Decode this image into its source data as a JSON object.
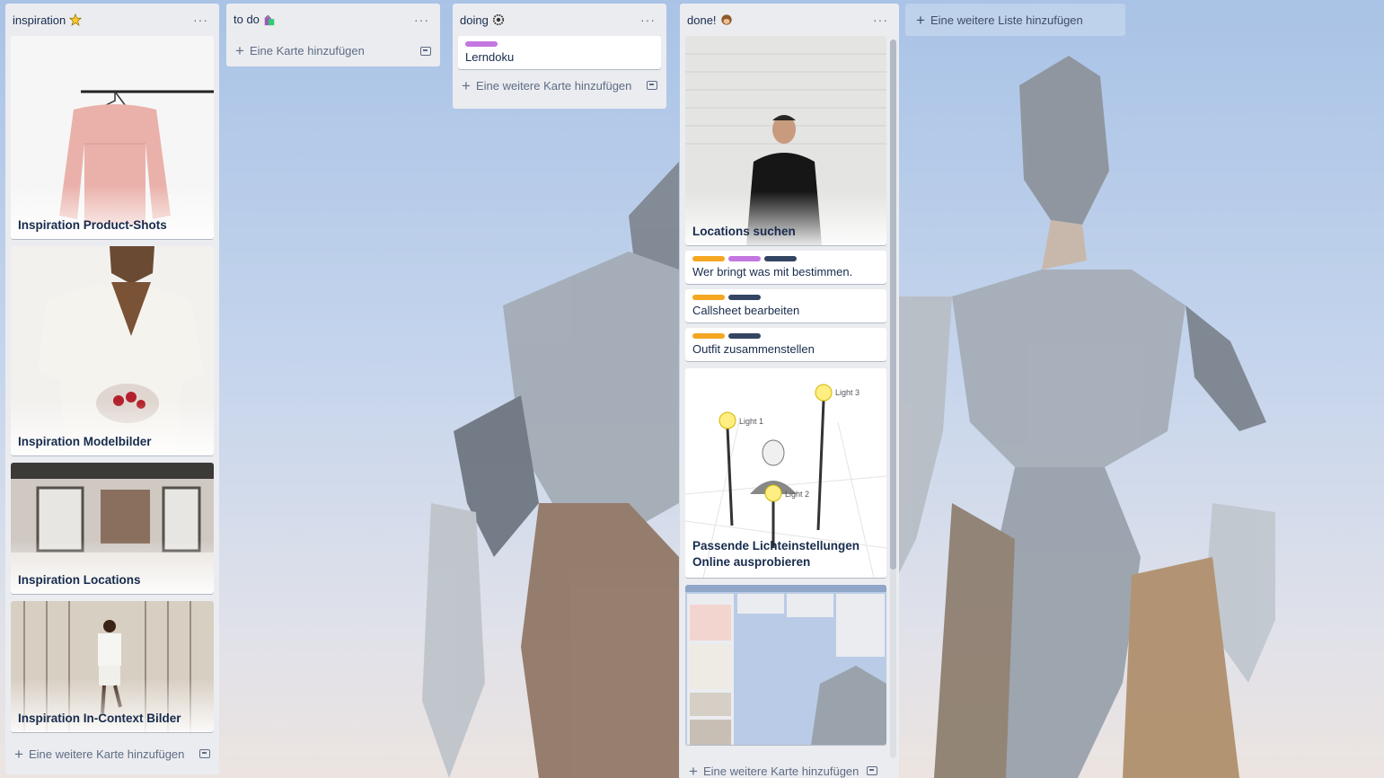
{
  "colors": {
    "label_orange": "#f5a623",
    "label_purple": "#c377e0",
    "label_navy": "#344563",
    "list_bg": "#ebecf0"
  },
  "lists": [
    {
      "title": "inspiration",
      "emoji": "star",
      "add_card": "Eine weitere Karte hinzufügen",
      "cards": [
        {
          "title": "Inspiration Product-Shots"
        },
        {
          "title": "Inspiration Modelbilder"
        },
        {
          "title": "Inspiration Locations"
        },
        {
          "title": "Inspiration In-Context Bilder"
        }
      ]
    },
    {
      "title": "to do",
      "emoji": "shopping-bags",
      "add_card": "Eine Karte hinzufügen"
    },
    {
      "title": "doing",
      "emoji": "gear",
      "add_card": "Eine weitere Karte hinzufügen",
      "cards": [
        {
          "title": "Lerndoku",
          "labels": [
            "purple"
          ]
        }
      ]
    },
    {
      "title": "done!",
      "emoji": "monkey",
      "add_card": "Eine weitere Karte hinzufügen",
      "cards": [
        {
          "title": "Locations suchen"
        },
        {
          "title": "Wer bringt was mit bestimmen.",
          "labels": [
            "orange",
            "purple",
            "navy"
          ]
        },
        {
          "title": "Callsheet bearbeiten",
          "labels": [
            "orange",
            "navy"
          ]
        },
        {
          "title": "Outfit zusammenstellen",
          "labels": [
            "orange",
            "navy"
          ]
        },
        {
          "title": "Passende Lichteinstellungen Online ausprobieren",
          "light_labels": [
            "Light 1",
            "Light 2",
            "Light 3"
          ]
        }
      ]
    }
  ],
  "add_list": "Eine weitere Liste hinzufügen",
  "list_menu_icon": "···"
}
